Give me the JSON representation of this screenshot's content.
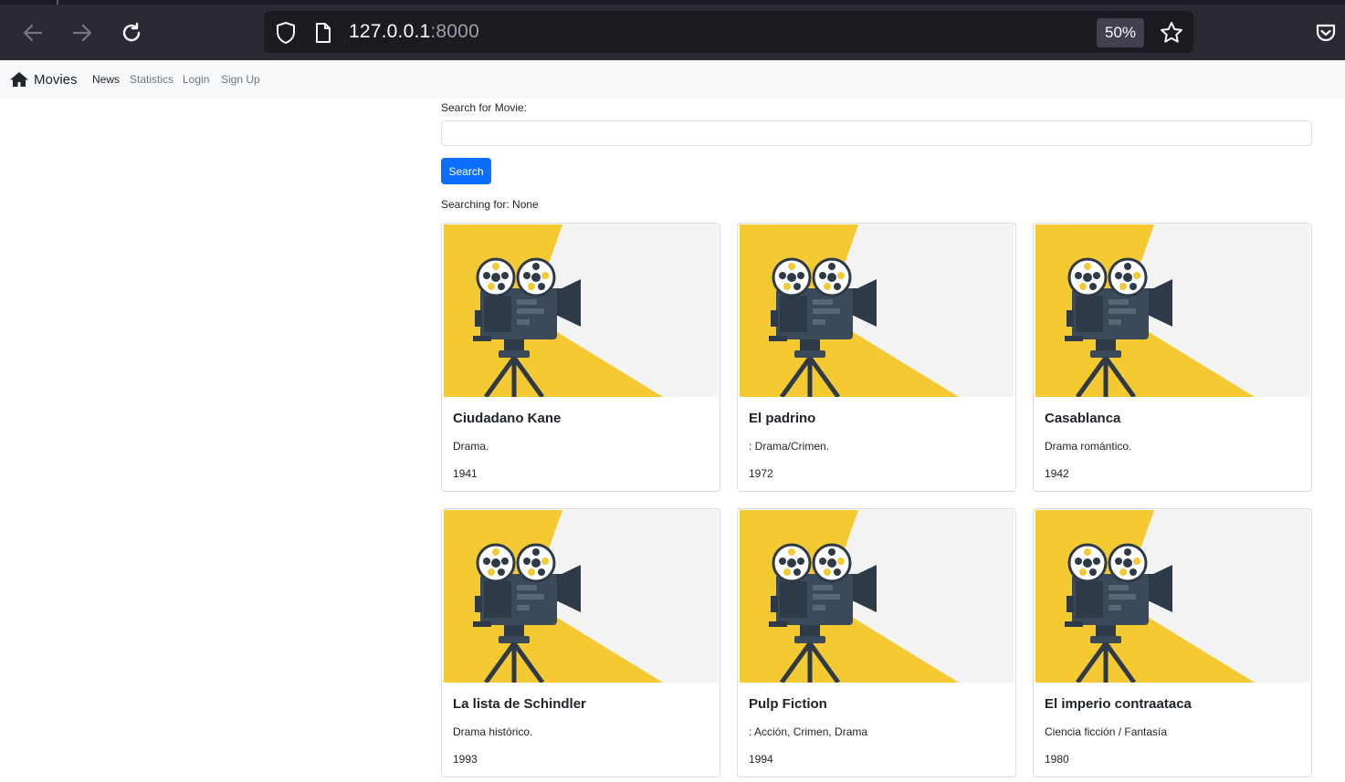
{
  "browser": {
    "url_host": "127.0.0.1",
    "url_port": ":8000",
    "zoom": "50%"
  },
  "navbar": {
    "brand": "Movies",
    "links": [
      "News",
      "Statistics",
      "Login",
      "Sign Up"
    ]
  },
  "search": {
    "label": "Search for Movie:",
    "value": "",
    "button": "Search",
    "status": "Searching for: None"
  },
  "movies": [
    {
      "title": "Ciudadano Kane",
      "genre": "Drama.",
      "year": "1941"
    },
    {
      "title": "El padrino",
      "genre": ": Drama/Crimen.",
      "year": "1972"
    },
    {
      "title": "Casablanca",
      "genre": "Drama romántico.",
      "year": "1942"
    },
    {
      "title": "La lista de Schindler",
      "genre": "Drama histórico.",
      "year": "1993"
    },
    {
      "title": "Pulp Fiction",
      "genre": ": Acción, Crimen, Drama",
      "year": "1994"
    },
    {
      "title": "El imperio contraataca",
      "genre": "Ciencia ficción / Fantasía",
      "year": "1980"
    }
  ],
  "colors": {
    "accent": "#0d6efd",
    "poster_yellow": "#f5c932",
    "camera_dark": "#2e3a48"
  },
  "icons": {
    "back": "back-arrow-icon",
    "forward": "forward-arrow-icon",
    "reload": "reload-icon",
    "shield": "shield-icon",
    "page": "page-icon",
    "bookmark": "star-icon",
    "pocket": "pocket-icon",
    "home": "home-icon"
  }
}
